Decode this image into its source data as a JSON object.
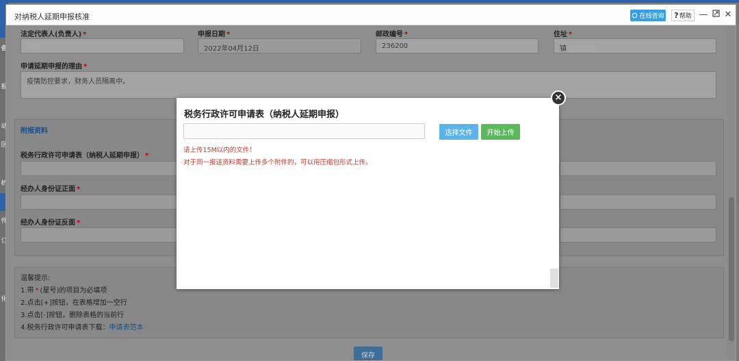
{
  "window": {
    "title": "对纳税人延期申报核准",
    "online_label": "在线咨询",
    "help_label": "帮助"
  },
  "side_chars": [
    "备",
    "报",
    "动",
    "区",
    "析",
    "件",
    "订",
    "化"
  ],
  "form": {
    "legal_rep": {
      "label": "法定代表人(负责人)",
      "value": ""
    },
    "apply_date": {
      "label": "申报日期",
      "value": "2022年04月12日"
    },
    "postcode": {
      "label": "邮政编号",
      "value": "236200"
    },
    "address": {
      "label": "住址",
      "value": "镇"
    },
    "reason": {
      "label": "申请延期申报的理由",
      "value": "疫情防控要求，财务人员隔离中。"
    },
    "attachments_title": "附报资料",
    "attach_1": {
      "label": "税务行政许可申请表（纳税人延期申报）"
    },
    "attach_2": {
      "label": "经办人身份证正面"
    },
    "attach_3": {
      "label": "经办人身份证反面"
    },
    "required_mark": "*"
  },
  "tips": {
    "heading": "温馨提示:",
    "line1_prefix": "1.带",
    "line1_star": "*",
    "line1_suffix": "(星号)的项目为必填项",
    "line2": "2.点击[+]按钮，在表格增加一空行",
    "line3": "3.点击[-]按钮，删除表格的当前行",
    "line4_prefix": "4.税务行政许可申请表下载：",
    "line4_link": "申请表范本"
  },
  "save_label": "保存",
  "modal": {
    "title": "税务行政许可申请表（纳税人延期申报）",
    "choose_label": "选择文件",
    "upload_label": "开始上传",
    "note1": "请上传15M以内的文件！",
    "note2": "对于同一报送资料需要上传多个附件的，可以用压缩包形式上传。",
    "close_glyph": "×"
  },
  "colors": {
    "accent_blue": "#5bb3e8",
    "upload_green": "#5cb85c",
    "note_red": "#c0392b"
  }
}
